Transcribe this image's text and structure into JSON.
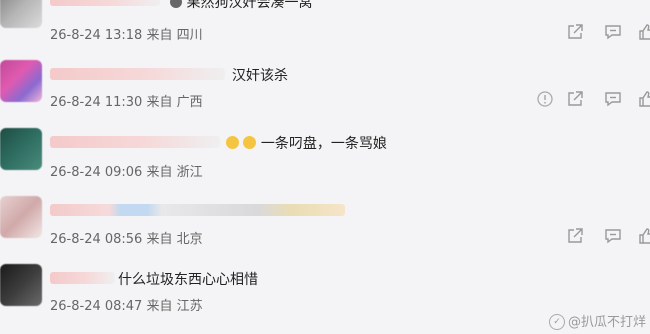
{
  "comments": [
    {
      "text": "果然狗汉奸会凑一窝",
      "time": "26-8-24 13:18",
      "from_label": "来自",
      "location": "四川"
    },
    {
      "text": "汉奸该杀",
      "time": "26-8-24 11:30",
      "from_label": "来自",
      "location": "广西"
    },
    {
      "text": "一条叼盘，一条骂娘",
      "time": "26-8-24 09:06",
      "from_label": "来自",
      "location": "浙江"
    },
    {
      "text": "",
      "time": "26-8-24 08:56",
      "from_label": "来自",
      "location": "北京"
    },
    {
      "text": "什么垃圾东西心心相惜",
      "time": "26-8-24 08:47",
      "from_label": "来自",
      "location": "江苏"
    }
  ],
  "icons": {
    "report": "report-icon",
    "share": "share-icon",
    "reply": "reply-icon",
    "like": "like-icon"
  },
  "watermark": {
    "text": "@扒瓜不打烊"
  },
  "colors": {
    "background": "#f4f4f6",
    "meta_text": "#666666",
    "icon": "#999999"
  }
}
